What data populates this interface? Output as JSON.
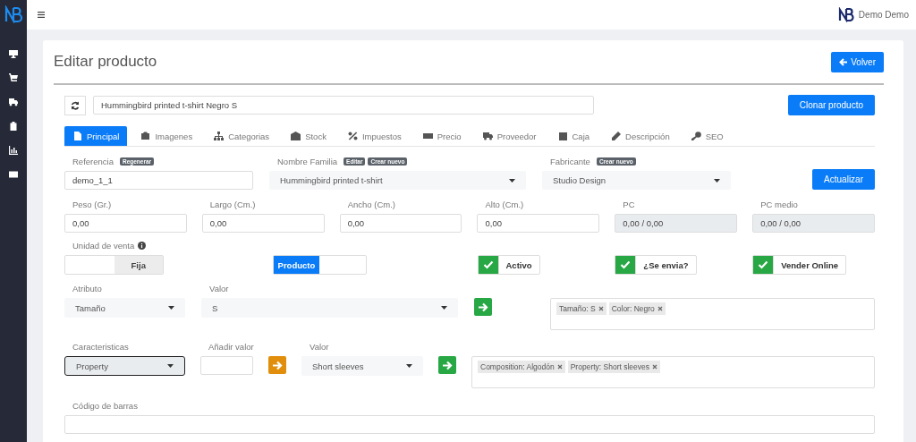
{
  "topbar": {
    "user": "Demo Demo"
  },
  "page": {
    "title": "Editar producto",
    "back_button": "Volver"
  },
  "product": {
    "name": "Hummingbird printed t-shirt Negro S",
    "clone_button": "Clonar producto"
  },
  "tabs": [
    {
      "label": "Principal",
      "selected": true
    },
    {
      "label": "Imagenes",
      "selected": false
    },
    {
      "label": "Categorias",
      "selected": false
    },
    {
      "label": "Stock",
      "selected": false
    },
    {
      "label": "Impuestos",
      "selected": false
    },
    {
      "label": "Precio",
      "selected": false
    },
    {
      "label": "Proveedor",
      "selected": false
    },
    {
      "label": "Caja",
      "selected": false
    },
    {
      "label": "Descripción",
      "selected": false
    },
    {
      "label": "SEO",
      "selected": false
    }
  ],
  "reference": {
    "label": "Referencia",
    "badges": [
      "Regenerar"
    ],
    "value": "demo_1_1"
  },
  "family": {
    "label": "Nombre Familia",
    "badges": [
      "Editar",
      "Crear nuevo"
    ],
    "value": "Hummingbird printed t-shirt"
  },
  "manufacturer": {
    "label": "Fabricante",
    "badges": [
      "Crear nuevo"
    ],
    "value": "Studio Design"
  },
  "update_button": "Actualizar",
  "measures": [
    {
      "label": "Peso (Gr.)",
      "value": "0,00",
      "disabled": false
    },
    {
      "label": "Largo (Cm.)",
      "value": "0,00",
      "disabled": false
    },
    {
      "label": "Ancho (Cm.)",
      "value": "0,00",
      "disabled": false
    },
    {
      "label": "Alto (Cm.)",
      "value": "0,00",
      "disabled": false
    },
    {
      "label": "PC",
      "value": "0,00 / 0,00",
      "disabled": true
    },
    {
      "label": "PC medio",
      "value": "0,00 / 0,00",
      "disabled": true
    }
  ],
  "sale_unit_label": "Unidad de venta",
  "toggles": [
    {
      "label": "Fija",
      "on": false
    },
    {
      "label": "Producto",
      "on": true
    }
  ],
  "checkboxes": [
    {
      "label": "Activo",
      "checked": true
    },
    {
      "label": "¿Se envia?",
      "checked": true
    },
    {
      "label": "Vender Online",
      "checked": true
    }
  ],
  "attribute": {
    "label": "Atributo",
    "value": "Tamaño",
    "value_label": "Valor",
    "value_value": "S",
    "tags": [
      "Tamaño: S",
      "Color: Negro"
    ]
  },
  "features": {
    "label": "Caracteristicas",
    "value": "Property",
    "focused": true,
    "add_label": "Añadir valor",
    "value_label": "Valor",
    "value_value": "Short sleeves",
    "tags": [
      "Composition: Algodón",
      "Property: Short sleeves"
    ]
  },
  "barcode": {
    "label": "Código de barras"
  }
}
